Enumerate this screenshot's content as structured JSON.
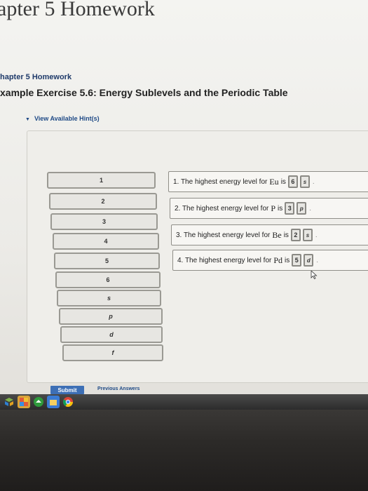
{
  "header": {
    "page_title": "apter 5 Homework",
    "breadcrumb": "hapter 5 Homework",
    "exercise_title": "xample Exercise 5.6: Energy Sublevels and the Periodic Table",
    "hints_label": "View Available Hint(s)"
  },
  "tiles": [
    "1",
    "2",
    "3",
    "4",
    "5",
    "6",
    "s",
    "p",
    "d",
    "f"
  ],
  "targets": [
    {
      "prefix": "1. The highest energy level for",
      "element": "Eu",
      "suffix": "is",
      "slot1": "6",
      "slot2": "s"
    },
    {
      "prefix": "2. The highest energy level for",
      "element": "P",
      "suffix": "is",
      "slot1": "3",
      "slot2": "p"
    },
    {
      "prefix": "3. The highest energy level for",
      "element": "Be",
      "suffix": "is",
      "slot1": "2",
      "slot2": "s"
    },
    {
      "prefix": "4. The highest energy level for",
      "element": "Pd",
      "suffix": "is",
      "slot1": "5",
      "slot2": "d"
    }
  ],
  "footer": {
    "submit_label": "Submit",
    "previous_answers_label": "Previous Answers"
  },
  "icons": {
    "hints_toggle": "triangle-down-icon",
    "cursor": "mouse-pointer-icon"
  },
  "colors": {
    "accent_blue": "#3d6fb5",
    "link_blue": "#1f4a86"
  }
}
